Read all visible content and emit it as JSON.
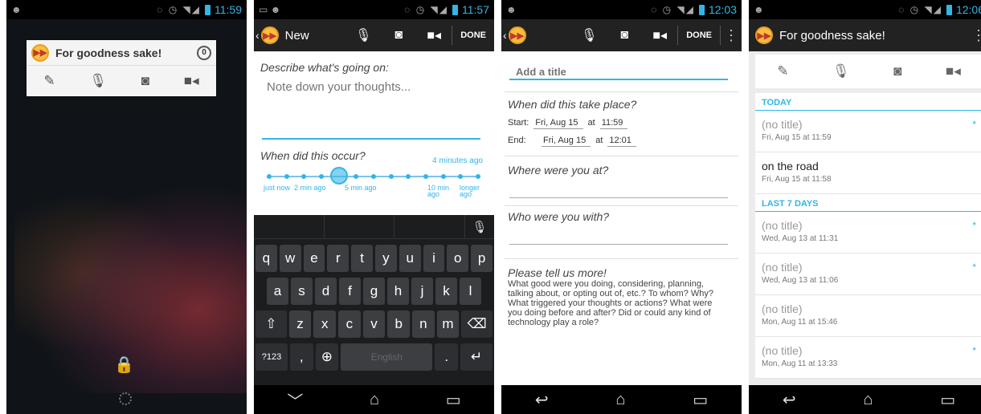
{
  "status": {
    "times": [
      "11:59",
      "11:57",
      "12:03",
      "12:06"
    ]
  },
  "widget": {
    "title": "For goodness sake!",
    "count": "0",
    "icons": [
      "edit-icon",
      "microphone-icon",
      "camera-icon",
      "video-icon"
    ]
  },
  "new_entry": {
    "action_title": "New",
    "done_label": "DONE",
    "describe_label": "Describe what's going on:",
    "note_placeholder": "Note down your thoughts...",
    "occur_label": "When did this occur?",
    "ago_label": "4 minutes ago",
    "slider_ticks": [
      {
        "text": "just now"
      },
      {
        "text": "2 min ago"
      },
      {
        "text": "5 min ago"
      },
      {
        "text": "10 min ago"
      },
      {
        "text": "longer ago"
      }
    ],
    "slider_value_index": 4,
    "slider_total": 13
  },
  "keyboard": {
    "row1": [
      "q",
      "w",
      "e",
      "r",
      "t",
      "y",
      "u",
      "i",
      "o",
      "p"
    ],
    "row2": [
      "a",
      "s",
      "d",
      "f",
      "g",
      "h",
      "j",
      "k",
      "l"
    ],
    "row3": [
      "z",
      "x",
      "c",
      "v",
      "b",
      "n",
      "m"
    ],
    "symbols_key": "?123",
    "comma_key": ",",
    "space_label": "English",
    "period_key": "."
  },
  "details": {
    "done_label": "DONE",
    "title_placeholder": "Add a title",
    "when_label": "When did this take place?",
    "start_label": "Start:",
    "start_date": "Fri, Aug 15",
    "start_time": "11:59",
    "end_label": "End:",
    "end_date": "Fri, Aug 15",
    "end_time": "12:01",
    "at_label": "at",
    "where_label": "Where were you at?",
    "who_label": "Who were you with?",
    "more_label": "Please tell us more!",
    "more_text": "What good were you doing, considering, planning, talking about, or opting out of, etc.? To whom? Why? What triggered your thoughts or actions? What were you doing before and after? Did or could any kind of technology play a role?"
  },
  "list": {
    "title": "For goodness sake!",
    "sections": [
      {
        "heading": "TODAY",
        "items": [
          {
            "title": "(no title)",
            "date": "Fri, Aug 15 at 11:59",
            "starred": true
          },
          {
            "title": "on the road",
            "date": "Fri, Aug 15 at 11:58",
            "starred": false
          }
        ]
      },
      {
        "heading": "LAST 7 DAYS",
        "items": [
          {
            "title": "(no title)",
            "date": "Wed, Aug 13 at 11:31",
            "starred": true
          },
          {
            "title": "(no title)",
            "date": "Wed, Aug 13 at 11:06",
            "starred": true
          },
          {
            "title": "(no title)",
            "date": "Mon, Aug 11 at 15:46",
            "starred": false
          },
          {
            "title": "(no title)",
            "date": "Mon, Aug 11 at 13:33",
            "starred": true
          }
        ]
      }
    ]
  },
  "colors": {
    "accent": "#33b5e5",
    "action_bar": "#222222",
    "logo": "#ffbd3f"
  }
}
